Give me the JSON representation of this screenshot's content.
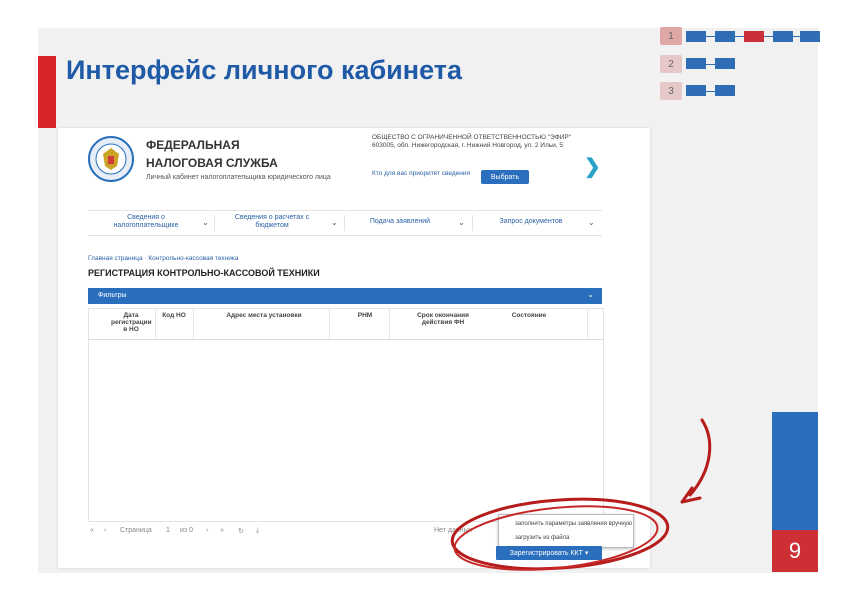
{
  "slide": {
    "title": "Интерфейс личного кабинета",
    "page_number": "9"
  },
  "nav": {
    "steps": [
      "1",
      "2",
      "3"
    ]
  },
  "site": {
    "org_name_line1": "ФЕДЕРАЛЬНАЯ",
    "org_name_line2": "НАЛОГОВАЯ СЛУЖБА",
    "subtitle": "Личный кабинет налогоплательщика юридического лица",
    "company_info": "ОБЩЕСТВО С ОГРАНИЧЕННОЙ ОТВЕТСТВЕННОСТЬЮ \"ЭФИР\" 603005, обл. Нижегородская, г. Нижний Новгород, ул. 2 Ильи, 5",
    "question": "Кто для вас приоритет сведения",
    "choose_button": "Выбрать"
  },
  "menu": {
    "items": [
      "Сведения о налогоплательщике",
      "Сведения о расчетах с бюджетом",
      "Подача заявлений",
      "Запрос документов"
    ]
  },
  "breadcrumb": "Главная страница · Контрольно-кассовая техника",
  "page_heading": "РЕГИСТРАЦИЯ КОНТРОЛЬНО-КАССОВОЙ ТЕХНИКИ",
  "filters_label": "Фильтры",
  "table": {
    "columns": [
      "Дата регистрации в НО",
      "Код НО",
      "Адрес места установки",
      "РНМ",
      "Срок окончания действия ФН",
      "Состояние"
    ]
  },
  "pager": {
    "page_label": "Страница",
    "page_value": "1",
    "of_label": "из 0",
    "no_data": "Нет данных"
  },
  "dropdown": {
    "option1": "заполнить параметры заявления вручную",
    "option2": "загрузить из файла"
  },
  "register_button": "Зарегистрировать ККТ"
}
